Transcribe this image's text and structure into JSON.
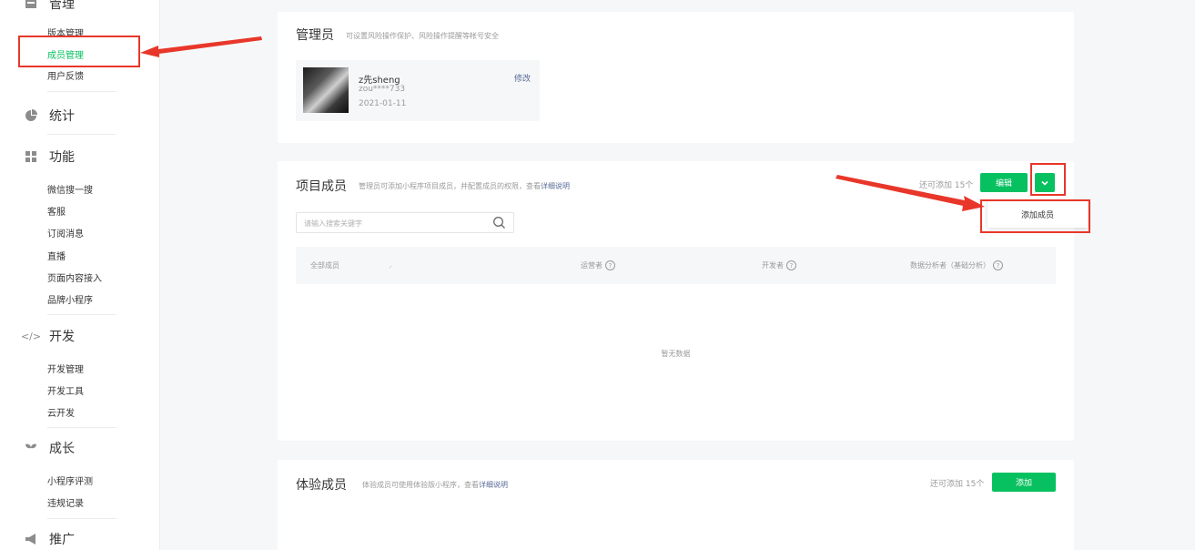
{
  "sidebar": {
    "manage": {
      "title": "管理",
      "items": [
        {
          "label": "版本管理"
        },
        {
          "label": "成员管理"
        },
        {
          "label": "用户反馈"
        }
      ]
    },
    "stats": {
      "title": "统计"
    },
    "features": {
      "title": "功能",
      "items": [
        {
          "label": "微信搜一搜"
        },
        {
          "label": "客服"
        },
        {
          "label": "订阅消息"
        },
        {
          "label": "直播"
        },
        {
          "label": "页面内容接入"
        },
        {
          "label": "品牌小程序"
        }
      ]
    },
    "develop": {
      "title": "开发",
      "items": [
        {
          "label": "开发管理"
        },
        {
          "label": "开发工具"
        },
        {
          "label": "云开发"
        }
      ]
    },
    "growth": {
      "title": "成长",
      "items": [
        {
          "label": "小程序评测"
        },
        {
          "label": "违规记录"
        }
      ]
    },
    "promote": {
      "title": "推广"
    }
  },
  "admin_card": {
    "title": "管理员",
    "desc": "可设置风险操作保护、风险操作提醒等帐号安全",
    "name": "z先sheng",
    "account": "zou****733",
    "date": "2021-01-11",
    "edit": "修改"
  },
  "project_card": {
    "title": "项目成员",
    "desc_prefix": "管理员可添加小程序项目成员，并配置成员的权限，查看",
    "desc_link": "详细说明",
    "remaining": "还可添加 15个",
    "edit_button": "编辑",
    "dropdown_item": "添加成员",
    "search_placeholder": "请输入搜索关键字",
    "columns": {
      "all": "全部成员",
      "operator": "运营者",
      "developer": "开发者",
      "analyst": "数据分析者（基础分析）"
    },
    "empty": "暂无数据"
  },
  "trial_card": {
    "title": "体验成员",
    "desc_prefix": "体验成员可使用体验版小程序，查看",
    "desc_link": "详细说明",
    "remaining": "还可添加 15个",
    "add_button": "添加"
  },
  "colors": {
    "brand_green": "#07c160",
    "link_blue": "#576b95",
    "annotation_red": "#e8372a"
  }
}
